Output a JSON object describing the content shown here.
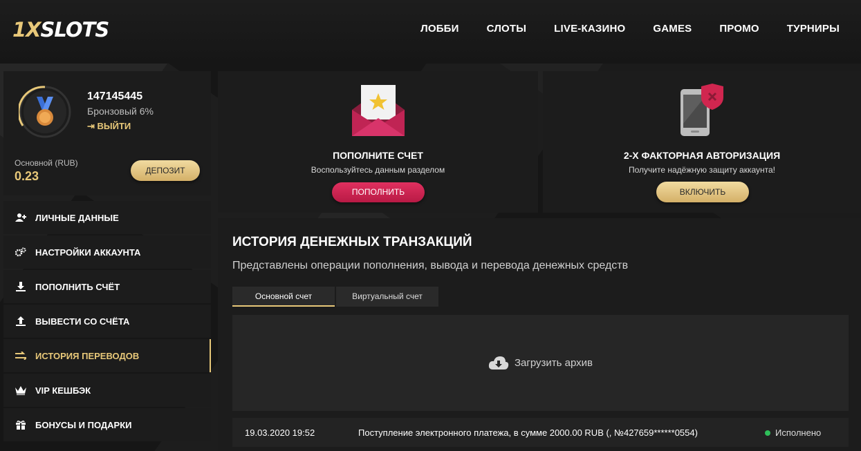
{
  "brand": {
    "logo_one": "1X",
    "logo_rest": "SLOTS"
  },
  "nav": [
    "ЛОББИ",
    "СЛОТЫ",
    "LIVE-КАЗИНО",
    "GAMES",
    "ПРОМО",
    "ТУРНИРЫ"
  ],
  "profile": {
    "user_id": "147145445",
    "rank": "Бронзовый 6%",
    "logout_label": "ВЫЙТИ",
    "balance_label": "Основной (RUB)",
    "balance_value": "0.23",
    "deposit_label": "ДЕПОЗИТ"
  },
  "menu": [
    {
      "label": "ЛИЧНЫЕ ДАННЫЕ",
      "icon": "user-plus-icon"
    },
    {
      "label": "НАСТРОЙКИ АККАУНТА",
      "icon": "gears-icon"
    },
    {
      "label": "ПОПОЛНИТЬ СЧЁТ",
      "icon": "download-icon"
    },
    {
      "label": "ВЫВЕСТИ СО СЧЁТА",
      "icon": "upload-icon"
    },
    {
      "label": "ИСТОРИЯ ПЕРЕВОДОВ",
      "icon": "transfer-arrows-icon",
      "active": true
    },
    {
      "label": "VIP КЕШБЭК",
      "icon": "crown-icon"
    },
    {
      "label": "БОНУСЫ И ПОДАРКИ",
      "icon": "gift-icon"
    }
  ],
  "card_deposit": {
    "title": "ПОПОЛНИТЕ СЧЕТ",
    "subtitle": "Воспользуйтесь данным разделом",
    "button": "ПОПОЛНИТЬ"
  },
  "card_2fa": {
    "title": "2-Х ФАКТОРНАЯ АВТОРИЗАЦИЯ",
    "subtitle": "Получите надёжную защиту аккаунта!",
    "button": "ВКЛЮЧИТЬ"
  },
  "history": {
    "title": "ИСТОРИЯ ДЕНЕЖНЫХ ТРАНЗАКЦИЙ",
    "subtitle": "Представлены операции пополнения, вывода и перевода денежных средств",
    "tabs": [
      "Основной счет",
      "Виртуальный счет"
    ],
    "archive_label": "Загрузить архив",
    "rows": [
      {
        "date": "19.03.2020 19:52",
        "description": "Поступление электронного платежа, в сумме 2000.00 RUB (, №427659******0554)",
        "status": "Исполнено"
      }
    ]
  },
  "colors": {
    "gold": "#e8c879",
    "red": "#d0264f",
    "success": "#2fbf5a"
  }
}
